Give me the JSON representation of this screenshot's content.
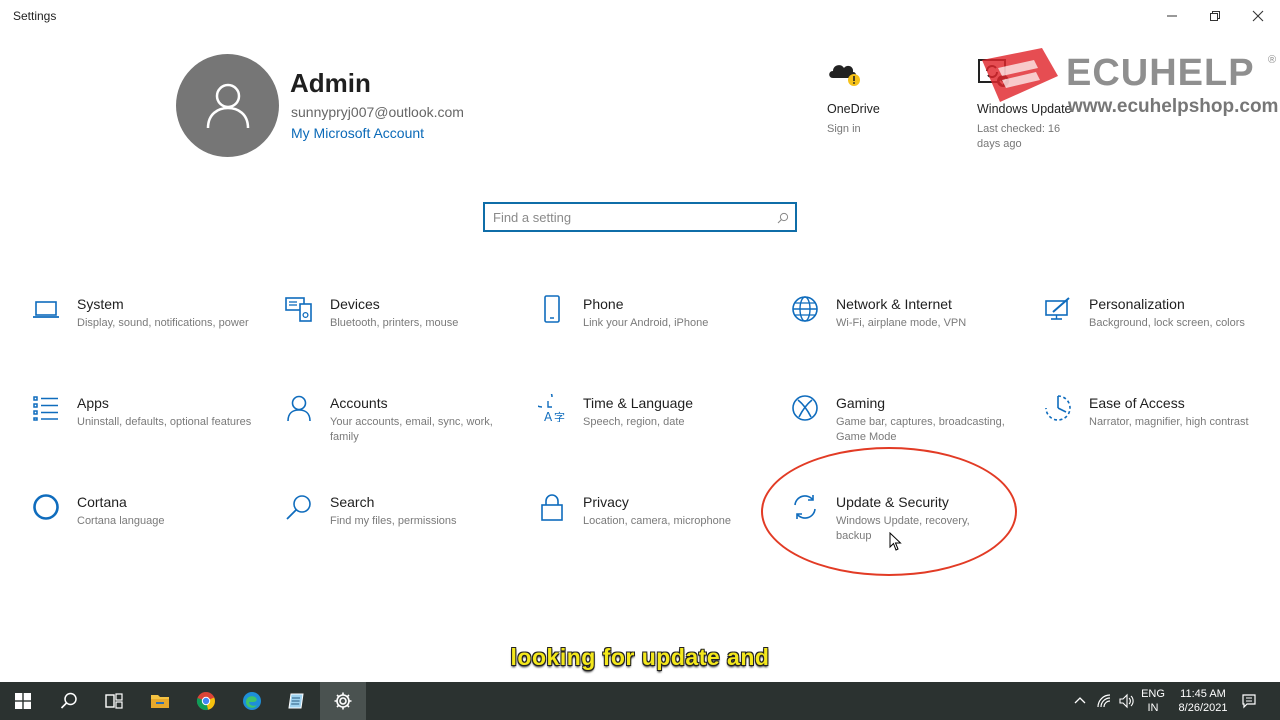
{
  "window": {
    "title": "Settings"
  },
  "account": {
    "name": "Admin",
    "email": "sunnypryj007@outlook.com",
    "link": "My Microsoft Account"
  },
  "quick": [
    {
      "title": "OneDrive",
      "subtitle": "Sign in",
      "icon": "onedrive-warning-icon"
    },
    {
      "title": "Windows Update",
      "subtitle": "Last checked: 16 days ago",
      "icon": "windows-update-icon"
    }
  ],
  "watermark": {
    "brand": "ECUHELP",
    "reg": "®",
    "url": "www.ecuhelpshop.com"
  },
  "search": {
    "placeholder": "Find a setting"
  },
  "tiles": [
    {
      "title": "System",
      "subtitle": "Display, sound, notifications, power",
      "icon": "laptop-icon"
    },
    {
      "title": "Devices",
      "subtitle": "Bluetooth, printers, mouse",
      "icon": "devices-icon"
    },
    {
      "title": "Phone",
      "subtitle": "Link your Android, iPhone",
      "icon": "phone-icon"
    },
    {
      "title": "Network & Internet",
      "subtitle": "Wi-Fi, airplane mode, VPN",
      "icon": "globe-icon"
    },
    {
      "title": "Personalization",
      "subtitle": "Background, lock screen, colors",
      "icon": "personalization-icon"
    },
    {
      "title": "Apps",
      "subtitle": "Uninstall, defaults, optional features",
      "icon": "apps-list-icon"
    },
    {
      "title": "Accounts",
      "subtitle": "Your accounts, email, sync, work, family",
      "icon": "person-icon"
    },
    {
      "title": "Time & Language",
      "subtitle": "Speech, region, date",
      "icon": "time-language-icon"
    },
    {
      "title": "Gaming",
      "subtitle": "Game bar, captures, broadcasting, Game Mode",
      "icon": "xbox-icon"
    },
    {
      "title": "Ease of Access",
      "subtitle": "Narrator, magnifier, high contrast",
      "icon": "ease-of-access-icon"
    },
    {
      "title": "Cortana",
      "subtitle": "Cortana language",
      "icon": "cortana-icon"
    },
    {
      "title": "Search",
      "subtitle": "Find my files, permissions",
      "icon": "search-icon"
    },
    {
      "title": "Privacy",
      "subtitle": "Location, camera, microphone",
      "icon": "lock-icon"
    },
    {
      "title": "Update & Security",
      "subtitle": "Windows Update, recovery, backup",
      "icon": "sync-icon"
    }
  ],
  "caption": "looking for update and",
  "taskbar": {
    "apps": [
      "start-icon",
      "search-icon",
      "task-view-icon",
      "file-explorer-icon",
      "chrome-icon",
      "edge-icon",
      "notepad-icon",
      "settings-gear-icon"
    ],
    "lang_top": "ENG",
    "lang_bottom": "IN",
    "time": "11:45 AM",
    "date": "8/26/2021"
  },
  "colors": {
    "accent": "#0b6ab8",
    "highlight": "#e23b25",
    "caption": "#f4e81c",
    "taskbar": "#2b3230"
  }
}
